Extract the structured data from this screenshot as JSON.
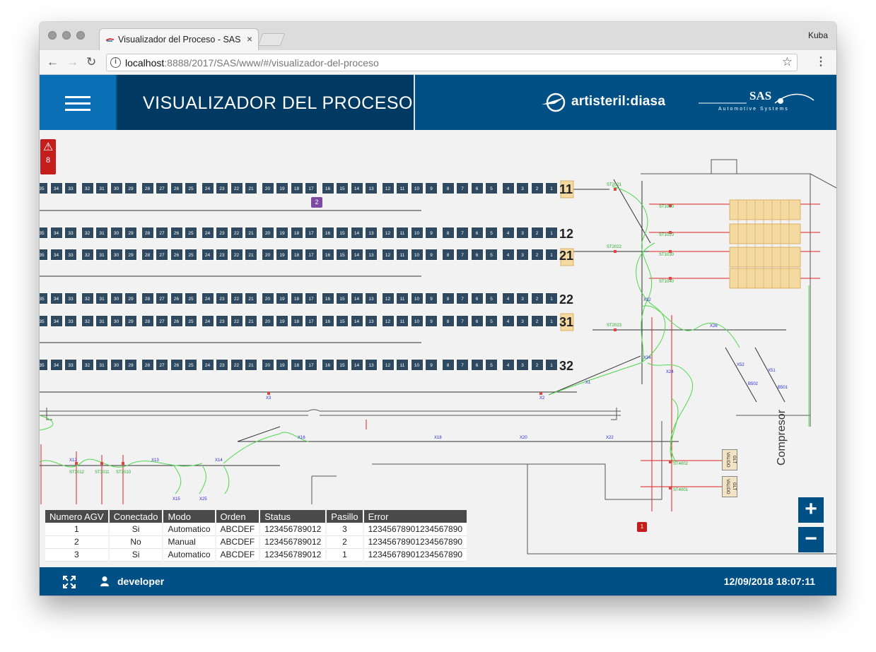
{
  "browser": {
    "tab_title": "Visualizador del Proceso - SAS",
    "tab_close": "×",
    "profile": "Kuba",
    "url_host": "localhost",
    "url_rest": ":8888/2017/SAS/www/#/visualizador-del-proceso"
  },
  "header": {
    "title": "VISUALIZADOR DEL PROCESO",
    "brand_primary": "artisteril:diasa",
    "brand_secondary": "SAS",
    "brand_secondary_sub": "Automotive Systems"
  },
  "alarm": {
    "icon": "warning-icon",
    "count": "8"
  },
  "map": {
    "slot_labels": [
      "35",
      "34",
      "33",
      "32",
      "31",
      "30",
      "29",
      "28",
      "27",
      "26",
      "25",
      "24",
      "23",
      "22",
      "21",
      "20",
      "19",
      "18",
      "17",
      "16",
      "15",
      "14",
      "13",
      "12",
      "11",
      "10",
      "9",
      "8",
      "7",
      "6",
      "5",
      "4",
      "3",
      "2",
      "1"
    ],
    "aisles": [
      "11",
      "12",
      "21",
      "22",
      "31",
      "32"
    ],
    "agv_markers": [
      "2",
      "1"
    ],
    "stations": [
      "ST2021",
      "ST2022",
      "ST2023",
      "ST1010",
      "ST1020",
      "ST1030",
      "ST1040",
      "ST4002",
      "ST4001",
      "ST3012",
      "ST3011",
      "ST3010"
    ],
    "crossings": [
      "X1",
      "X2",
      "X3",
      "X12",
      "X13",
      "X14",
      "X15",
      "X16",
      "X18",
      "X20",
      "X22",
      "X24",
      "X25",
      "X26",
      "X32",
      "X34",
      "X51",
      "X52",
      "B502",
      "B501"
    ],
    "compresor_label": "Compresor",
    "valido_label": "GLT VALIDO"
  },
  "agv_table": {
    "headers": [
      "Numero AGV",
      "Conectado",
      "Modo",
      "Orden",
      "Status",
      "Pasillo",
      "Error"
    ],
    "rows": [
      [
        "1",
        "Si",
        "Automatico",
        "ABCDEF",
        "123456789012",
        "3",
        "12345678901234567890"
      ],
      [
        "2",
        "No",
        "Manual",
        "ABCDEF",
        "123456789012",
        "2",
        "12345678901234567890"
      ],
      [
        "3",
        "Si",
        "Automatico",
        "ABCDEF",
        "123456789012",
        "1",
        "12345678901234567890"
      ]
    ]
  },
  "zoom": {
    "in": "+",
    "out": "−"
  },
  "footer": {
    "user": "developer",
    "datetime": "12/09/2018 18:07:11"
  }
}
